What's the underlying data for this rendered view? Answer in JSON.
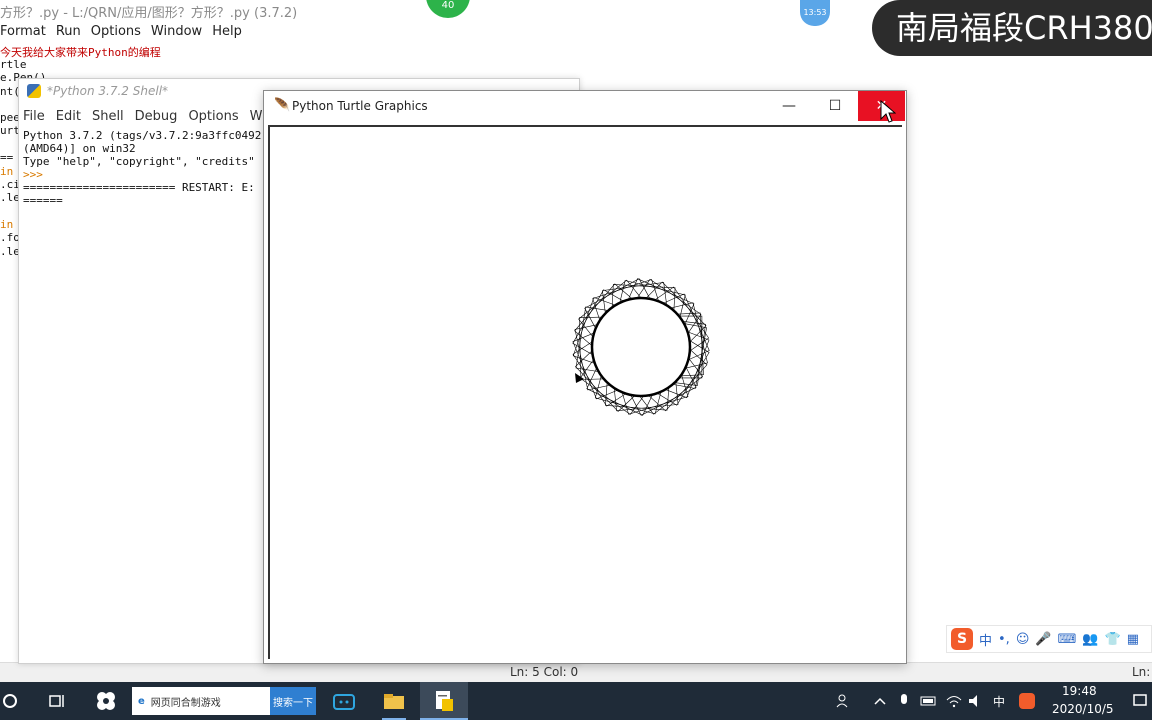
{
  "editor": {
    "title": "方形？.py - L:/QRN/应用/图形？方形？.py (3.7.2)",
    "menu": [
      "Format",
      "Run",
      "Options",
      "Window",
      "Help"
    ],
    "code_lines": [
      "今天我给大家带来Python的编程",
      "rtle",
      "e.Pen()",
      "nt(",
      "pee",
      "urt",
      "==",
      "in",
      ".ci",
      ".le",
      "in",
      ".fo",
      ".le"
    ],
    "status": "Ln: 5  Col: 0",
    "status_right": "Ln:"
  },
  "shell": {
    "title": "*Python 3.7.2 Shell*",
    "menu": [
      "File",
      "Edit",
      "Shell",
      "Debug",
      "Options",
      "Windo"
    ],
    "lines": [
      "Python 3.7.2 (tags/v3.7.2:9a3ffc0492",
      "(AMD64)] on win32",
      "Type \"help\", \"copyright\", \"credits\"",
      ">>>",
      "======================= RESTART: E:",
      "======"
    ]
  },
  "turtle_window": {
    "title": "Python Turtle Graphics",
    "min_symbol": "—",
    "max_symbol": "☐",
    "close_symbol": "✕"
  },
  "overlays": {
    "green_badge": "40",
    "blue_badge": "13:53",
    "watermark": "南局福段CRH380"
  },
  "ime": {
    "logo": "S",
    "items": [
      "中",
      "•,",
      "☺",
      "🎤",
      "⌨",
      "👥",
      "👕",
      "▦"
    ]
  },
  "taskbar": {
    "search_text": "网页同合制游戏",
    "search_button": "搜索一下",
    "time": "19:48",
    "date": "2020/10/5",
    "tray_ime": "中"
  },
  "colors": {
    "taskbar": "#1f2b38",
    "close_button": "#e81123",
    "code_comment": "#c00000"
  }
}
